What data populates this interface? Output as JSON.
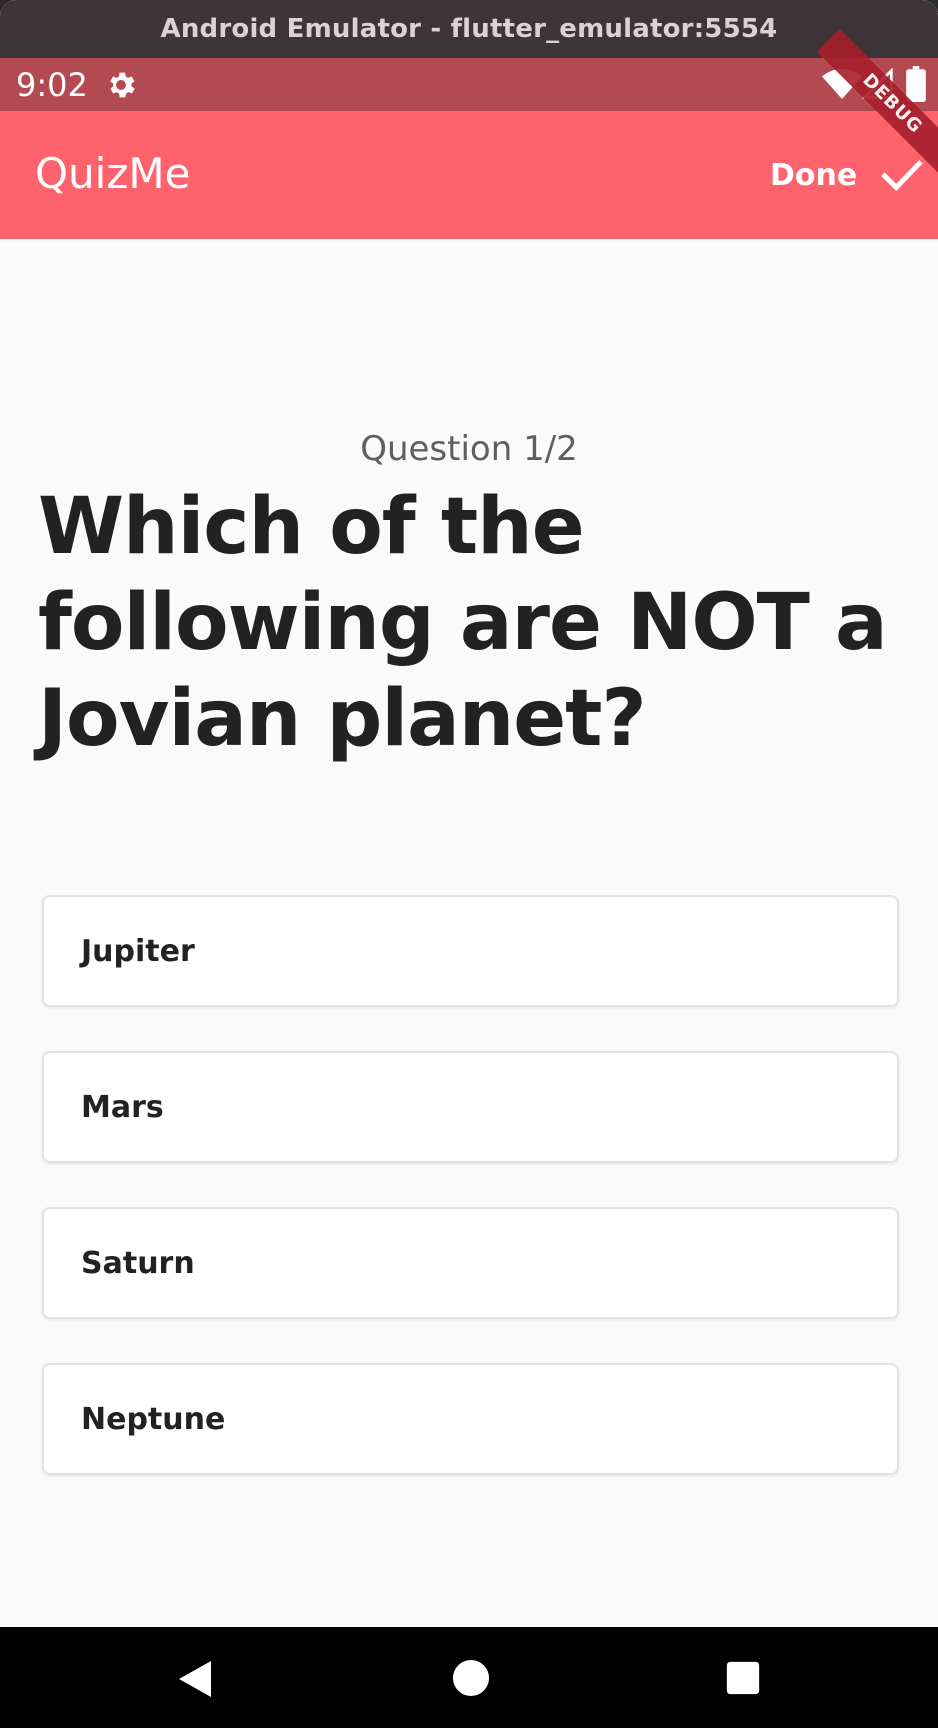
{
  "window": {
    "title": "Android Emulator - flutter_emulator:5554"
  },
  "status_bar": {
    "time": "9:02",
    "icons": [
      "settings-gear-icon",
      "wifi-icon",
      "signal-icon",
      "battery-icon"
    ]
  },
  "app_bar": {
    "title": "QuizMe",
    "done_label": "Done",
    "done_icon": "check-icon",
    "debug_banner": "DEBUG"
  },
  "quiz": {
    "counter": "Question 1/2",
    "question": "Which of the following are NOT a Jovian planet?",
    "answers": [
      {
        "label": "Jupiter"
      },
      {
        "label": "Mars"
      },
      {
        "label": "Saturn"
      },
      {
        "label": "Neptune"
      }
    ]
  },
  "nav_bar": {
    "icons": [
      "back-icon",
      "home-icon",
      "recents-icon"
    ]
  },
  "colors": {
    "app_bar": "#fe626d",
    "status_bar": "#b34a52",
    "background": "#fafafa",
    "card": "#ffffff",
    "text": "#222222"
  }
}
